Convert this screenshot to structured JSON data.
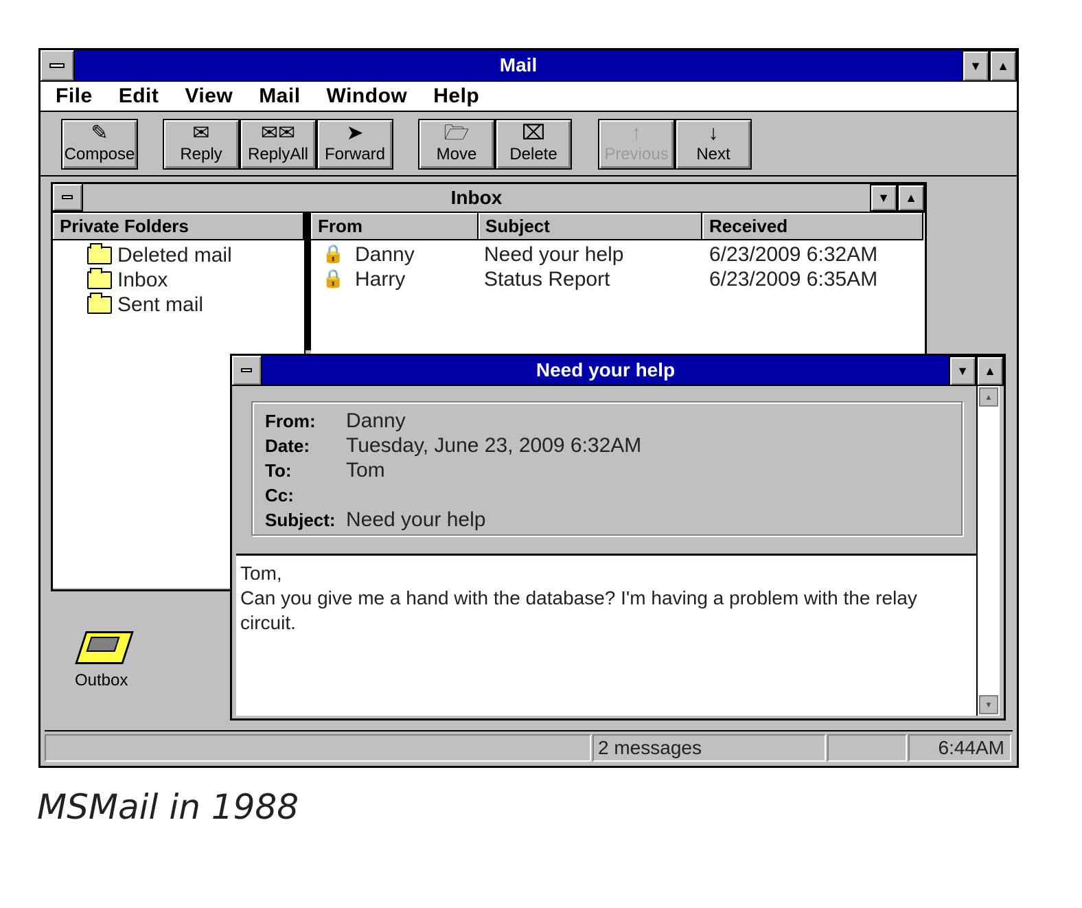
{
  "app": {
    "title": "Mail"
  },
  "menu": [
    "File",
    "Edit",
    "View",
    "Mail",
    "Window",
    "Help"
  ],
  "toolbar": {
    "compose": "Compose",
    "reply": "Reply",
    "reply_all": "ReplyAll",
    "forward": "Forward",
    "move": "Move",
    "delete": "Delete",
    "previous": "Previous",
    "next": "Next"
  },
  "inbox": {
    "title": "Inbox",
    "folders_header": "Private Folders",
    "folders": [
      "Deleted mail",
      "Inbox",
      "Sent mail"
    ],
    "columns": {
      "from": "From",
      "subject": "Subject",
      "received": "Received"
    },
    "messages": [
      {
        "from": "Danny",
        "subject": "Need your help",
        "received": "6/23/2009 6:32AM"
      },
      {
        "from": "Harry",
        "subject": "Status Report",
        "received": "6/23/2009 6:35AM"
      }
    ]
  },
  "outbox": {
    "label": "Outbox"
  },
  "message": {
    "title": "Need your help",
    "labels": {
      "from": "From:",
      "date": "Date:",
      "to": "To:",
      "cc": "Cc:",
      "subject": "Subject:"
    },
    "from": "Danny",
    "date": "Tuesday, June 23, 2009 6:32AM",
    "to": "Tom",
    "cc": "",
    "subject": "Need your help",
    "body_line1": "Tom,",
    "body_line2": "Can you give me a hand with the database? I'm having a problem with the relay circuit."
  },
  "status": {
    "count": "2 messages",
    "time": "6:44AM"
  },
  "caption": "MSMail in 1988",
  "colors": {
    "titlebar_active": "#0000a8",
    "window_face": "#c0c0c0",
    "folder": "#ffff80"
  }
}
